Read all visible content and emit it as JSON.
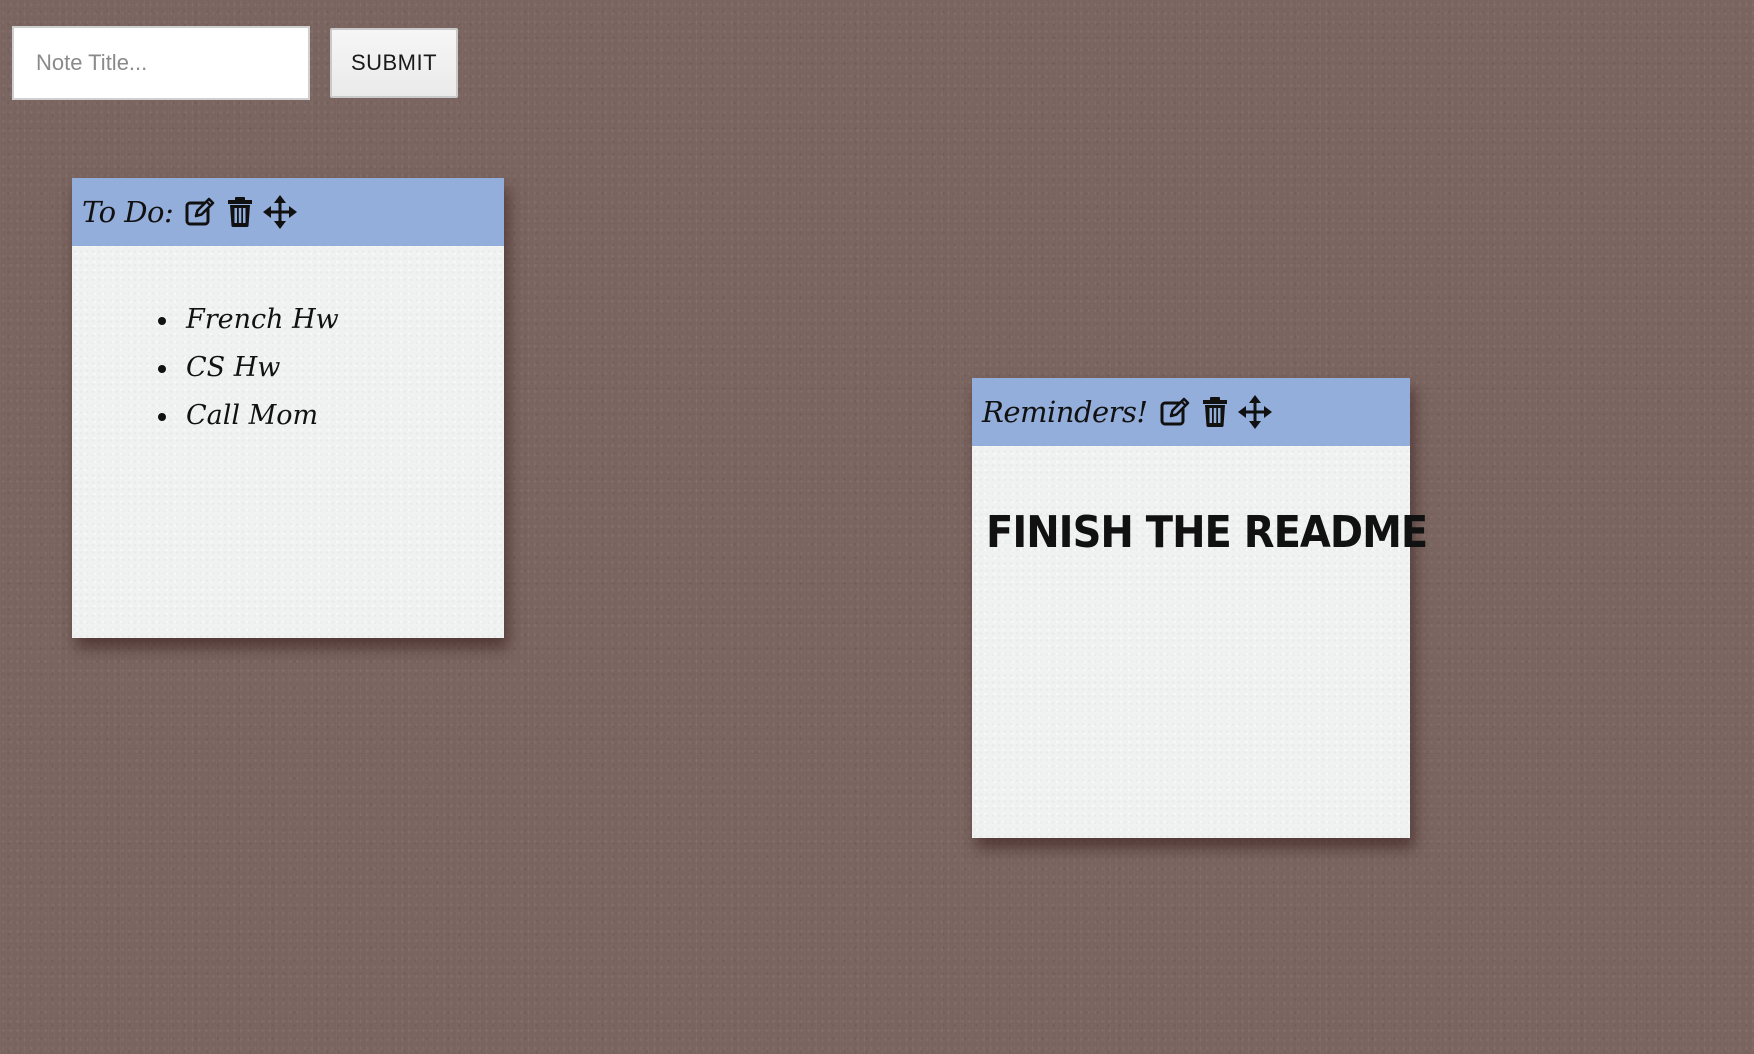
{
  "form": {
    "title_placeholder": "Note Title...",
    "title_value": "",
    "submit_label": "SUBMIT"
  },
  "notes": [
    {
      "title": "To Do:",
      "items": [
        "French Hw",
        "CS Hw",
        "Call Mom"
      ]
    },
    {
      "title": "Reminders!",
      "content": "FINISH THE README"
    }
  ],
  "icons": {
    "edit": "edit-icon",
    "delete": "trash-icon",
    "move": "move-arrows-icon"
  },
  "colors": {
    "board_background": "#7b6560",
    "note_header": "#94aedb",
    "note_body": "#f0f1f1"
  }
}
